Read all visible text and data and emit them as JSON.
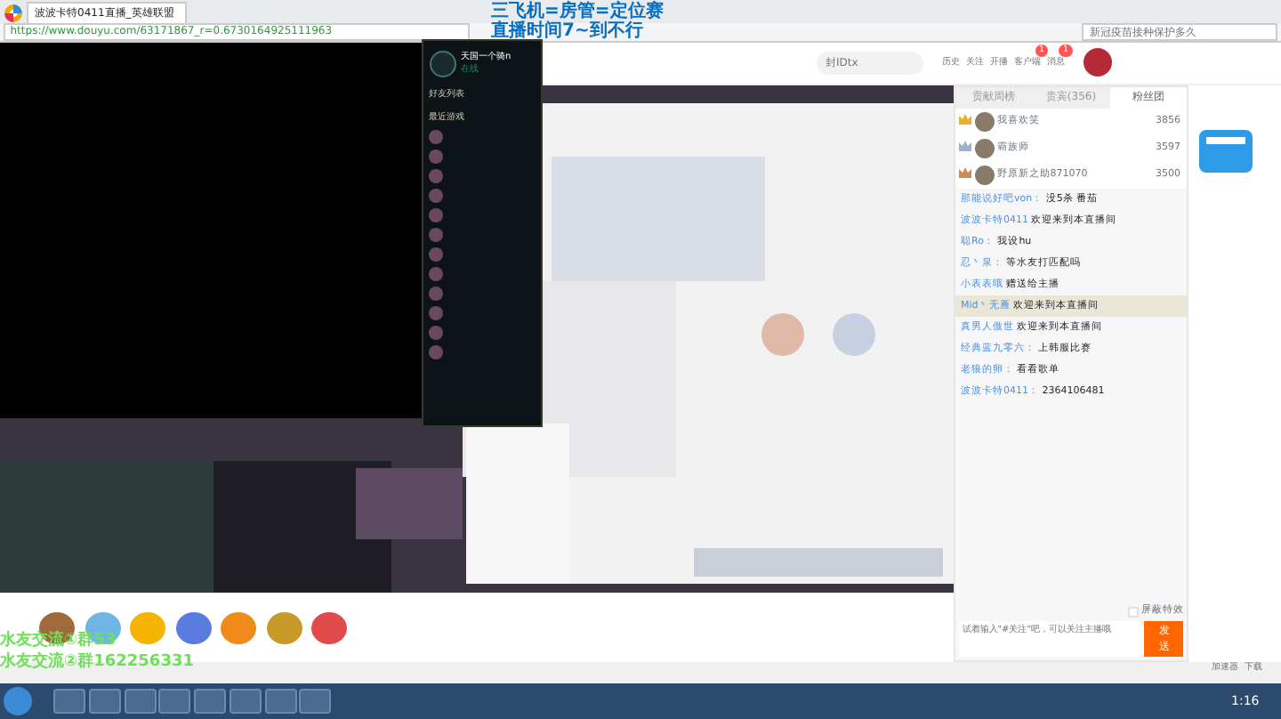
{
  "browser": {
    "tab_title": "波波卡特0411直播_英雄联盟",
    "url": "https://www.douyu.com/63171867_r=0.6730164925111963",
    "search_placeholder": "新冠疫苗接种保护多久"
  },
  "overlay_top": [
    "三飞机=房管=定位赛",
    "直播时间7~到不行"
  ],
  "overlay_bottom": [
    "水友交流①群53",
    "水友交流②群162256331"
  ],
  "friends": {
    "user": "天国一个骑n",
    "status": "在线",
    "title": "好友列表",
    "section": "最近游戏"
  },
  "header": {
    "search_placeholder": "封IDtx",
    "nav": [
      {
        "label": "历史"
      },
      {
        "label": "关注"
      },
      {
        "label": "开播"
      },
      {
        "label": "客户端",
        "badge": "1"
      },
      {
        "label": "消息",
        "badge": "1"
      }
    ]
  },
  "chat": {
    "tabs": [
      {
        "label": "贡献周榜",
        "selected": false
      },
      {
        "label": "贵宾(356)",
        "selected": false
      },
      {
        "label": "粉丝团",
        "selected": true
      }
    ],
    "ranks": [
      {
        "name": "我喜欢笑",
        "score": "3856",
        "color": "#e8b32a"
      },
      {
        "name": "霸族师",
        "score": "3597",
        "color": "#9fb0c8"
      },
      {
        "name": "野原新之助871070",
        "score": "3500",
        "color": "#d08a5a"
      }
    ],
    "messages": [
      {
        "user": "那能说好吧von：",
        "text": "没5杀 番茄",
        "highlight": false
      },
      {
        "user": "波波卡特0411",
        "text": "欢迎来到本直播间",
        "highlight": false
      },
      {
        "user": "聪Ro：",
        "text": "我设hu",
        "highlight": false
      },
      {
        "user": "忍丶泉：",
        "text": "等水友打匹配吗",
        "highlight": false
      },
      {
        "user": "小表表哦",
        "text": "赠送给主播",
        "highlight": false
      },
      {
        "user": "Mid丶无雁",
        "text": "欢迎来到本直播间",
        "highlight": true
      },
      {
        "user": "真男人傲世",
        "text": "欢迎来到本直播间",
        "highlight": false
      },
      {
        "user": "经典蓝九零六：",
        "text": "上韩服比赛",
        "highlight": false
      },
      {
        "user": "老狼的卵：",
        "text": "看看歌单",
        "highlight": false
      },
      {
        "user": "波波卡特0411：",
        "text": "2364106481",
        "highlight": false
      }
    ],
    "shield_label": "屏蔽特效",
    "shield_checked": false,
    "input_placeholder": "试着输入\"#关注\"吧，可以关注主播哦",
    "send": "发送"
  },
  "status_bar": [
    "加速器",
    "下载"
  ],
  "taskbar": {
    "time": "1:16"
  }
}
